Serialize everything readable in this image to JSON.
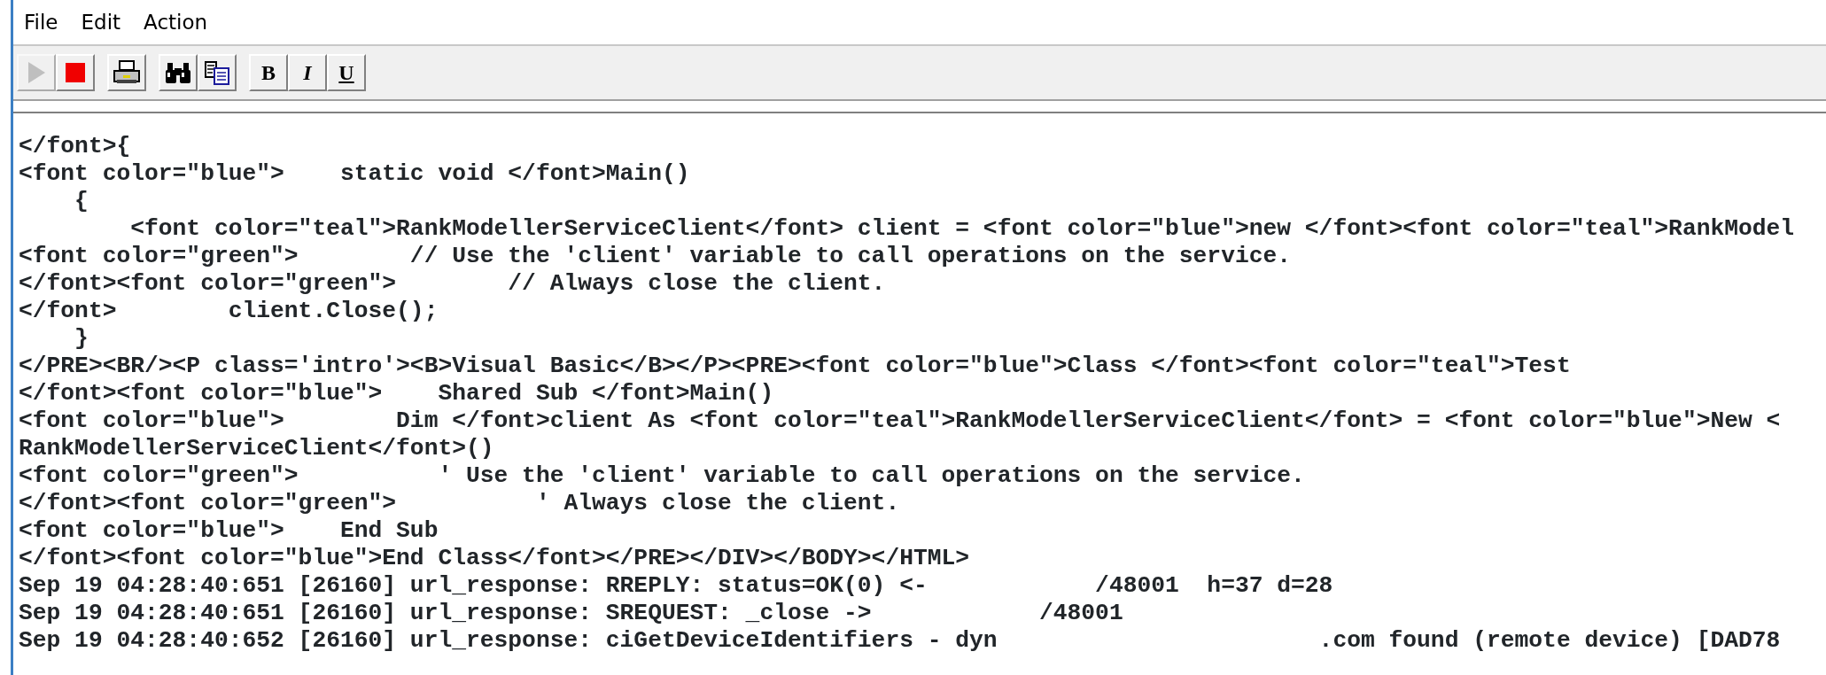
{
  "menu": [
    "File",
    "Edit",
    "Action"
  ],
  "toolbar": [
    {
      "kind": "play",
      "disabled": true
    },
    {
      "kind": "stop",
      "disabled": false
    },
    {
      "kind": "sep"
    },
    {
      "kind": "print",
      "disabled": false
    },
    {
      "kind": "sep"
    },
    {
      "kind": "find",
      "disabled": false
    },
    {
      "kind": "copy",
      "disabled": false
    },
    {
      "kind": "sep"
    },
    {
      "kind": "bold",
      "label": "B",
      "disabled": false
    },
    {
      "kind": "italic",
      "label": "I",
      "disabled": false
    },
    {
      "kind": "underline",
      "label": "U",
      "disabled": false
    }
  ],
  "log_lines": [
    "</font>{",
    "<font color=\"blue\">    static void </font>Main()",
    "    {",
    "        <font color=\"teal\">RankModellerServiceClient</font> client = <font color=\"blue\">new </font><font color=\"teal\">RankModel",
    "<font color=\"green\">        // Use the 'client' variable to call operations on the service.",
    "</font><font color=\"green\">        // Always close the client.",
    "</font>        client.Close();",
    "    }",
    "</PRE><BR/><P class='intro'><B>Visual Basic</B></P><PRE><font color=\"blue\">Class </font><font color=\"teal\">Test",
    "</font><font color=\"blue\">    Shared Sub </font>Main()",
    "<font color=\"blue\">        Dim </font>client As <font color=\"teal\">RankModellerServiceClient</font> = <font color=\"blue\">New <",
    "RankModellerServiceClient</font>()",
    "<font color=\"green\">          ' Use the 'client' variable to call operations on the service.",
    "</font><font color=\"green\">          ' Always close the client.",
    "<font color=\"blue\">    End Sub",
    "</font><font color=\"blue\">End Class</font></PRE></DIV></BODY></HTML>",
    "Sep 19 04:28:40:651 [26160] url_response: RREPLY: status=OK(0) <-            /48001  h=37 d=28",
    "Sep 19 04:28:40:651 [26160] url_response: SREQUEST: _close ->            /48001",
    "Sep 19 04:28:40:652 [26160] url_response: ciGetDeviceIdentifiers - dyn                       .com found (remote device) [DAD78"
  ]
}
